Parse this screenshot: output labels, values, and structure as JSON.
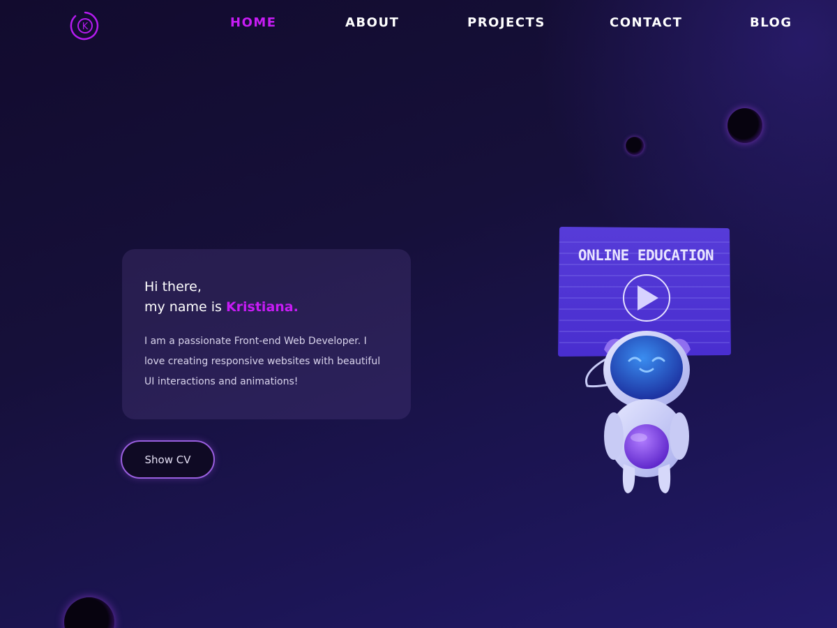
{
  "nav": {
    "logo_letter": "K",
    "items": [
      {
        "label": "HOME",
        "active": true
      },
      {
        "label": "ABOUT",
        "active": false
      },
      {
        "label": "PROJECTS",
        "active": false
      },
      {
        "label": "CONTACT",
        "active": false
      },
      {
        "label": "BLOG",
        "active": false
      }
    ]
  },
  "intro": {
    "greeting": "Hi there,",
    "name_prefix": "my name is ",
    "name": "Kristiana.",
    "bio": "I am a passionate Front-end Web Developer. I love creating responsive websites with beautiful UI interactions and animations!"
  },
  "cta": {
    "label": "Show CV"
  },
  "illustration": {
    "screen_title": "ONLINE EDUCATION"
  },
  "colors": {
    "accent": "#c71cf5",
    "background": "#16103a",
    "nav_text": "#ffffff"
  }
}
